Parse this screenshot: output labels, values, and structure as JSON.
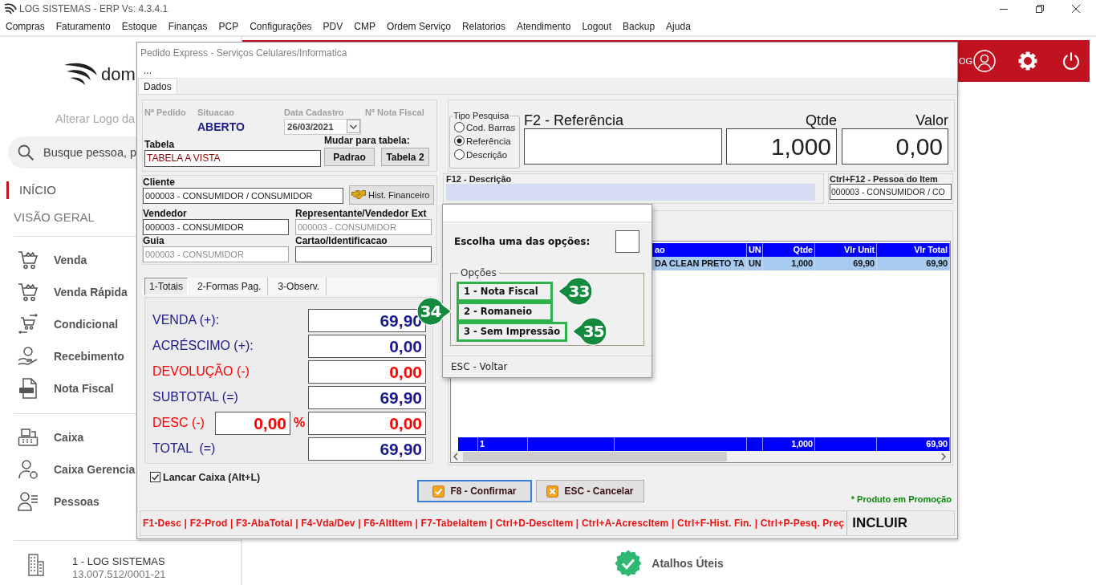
{
  "window": {
    "title": "LOG SISTEMAS - ERP Vs: 4.3.4.1"
  },
  "menu": [
    "Compras",
    "Faturamento",
    "Estoque",
    "Finanças",
    "PCP",
    "Configurações",
    "PDV",
    "CMP",
    "Ordem Serviço",
    "Relatorios",
    "Atendimento",
    "Logout",
    "Backup",
    "Ajuda"
  ],
  "sidebar": {
    "logo_text": "dom",
    "logo_caption": "Alterar Logo da",
    "search": {
      "placeholder": "Busque pessoa, p"
    },
    "sections": [
      {
        "label": "INÍCIO",
        "selected": true
      },
      {
        "label": "VISÃO GERAL",
        "selected": false
      }
    ],
    "groups": [
      [
        "Venda",
        "Venda Rápida",
        "Condicional",
        "Recebimento",
        "Nota Fiscal"
      ],
      [
        "Caixa",
        "Caixa Gerencia",
        "Pessoas"
      ]
    ],
    "company": {
      "name": "1 - LOG SISTEMAS",
      "document": "13.007.512/0001-21"
    }
  },
  "header": {
    "user": "OG"
  },
  "shortcuts_link": "Atalhos Úteis",
  "dialog": {
    "title": "Pedido Express - Serviços Celulares/Informatica",
    "menu_label": "...",
    "tabs": [
      {
        "label": "Dados",
        "selected": true
      }
    ],
    "order": {
      "number_label": "Nº Pedido",
      "status_label": "Situacao",
      "status": "ABERTO",
      "date_label": "Data Cadastro",
      "date": "26/03/2021",
      "invoice_label": "Nº Nota Fiscal",
      "table_label": "Tabela",
      "table": "TABELA A VISTA",
      "change_table_label": "Mudar para tabela:",
      "table_buttons": [
        "Padrao",
        "Tabela 2"
      ]
    },
    "people": {
      "client": {
        "label": "Cliente",
        "value": "000003 - CONSUMIDOR / CONSUMIDOR"
      },
      "history_button": "Hist. Financeiro",
      "fields": [
        {
          "label": "Vendedor",
          "value": "000003 - CONSUMIDOR",
          "disabled": false
        },
        {
          "label": "Representante/Vendedor Ext",
          "value": "000003 - CONSUMIDOR",
          "disabled": true
        },
        {
          "label": "Guia",
          "value": "000003 - CONSUMIDOR",
          "disabled": true
        },
        {
          "label": "Cartao/Identificacao",
          "disabled": false
        }
      ]
    },
    "totals_tabs": [
      {
        "label": "1-Totais",
        "selected": true
      },
      {
        "label": "2-Formas Pag.",
        "selected": false
      },
      {
        "label": "3-Observ.",
        "selected": false
      }
    ],
    "totals": [
      {
        "kind": "plain",
        "label": "VENDA (+):",
        "value": "69,90",
        "color": "#1a1a8c"
      },
      {
        "kind": "plain",
        "label": "ACRÉSCIMO (+):",
        "value": "0,00",
        "color": "#1a1a8c"
      },
      {
        "kind": "plain",
        "label": "DEVOLUÇÃO (-)",
        "value": "0,00",
        "color": "#ff0000"
      },
      {
        "kind": "plain",
        "label": "SUBTOTAL (=)",
        "value": "69,90",
        "color": "#1a1a8c"
      },
      {
        "kind": "percent",
        "label": "DESC (-)",
        "percent": "0,00",
        "percent_sign": "%",
        "value": "0,00",
        "color": "#ff0000"
      },
      {
        "kind": "plain",
        "label": "TOTAL  (=)",
        "value": "69,90",
        "color": "#1a1a8c"
      }
    ],
    "search": {
      "type_title": "Tipo Pesquisa",
      "types": [
        {
          "label": "Cod. Barras",
          "selected": false
        },
        {
          "label": "Referência",
          "selected": true
        },
        {
          "label": "Descrição",
          "selected": false
        }
      ],
      "reference_label": "F2 - Referência",
      "quantity_label": "Qtde",
      "quantity": "1,000",
      "price_label": "Valor",
      "price": "0,00"
    },
    "description_label": "F12 - Descrição",
    "item_person": {
      "label": "Ctrl+F12 - Pessoa do Item",
      "value": "000003 - CONSUMIDOR / CO"
    },
    "grid": {
      "columns": [
        "ao",
        "UN",
        "Qtde",
        "Vlr Unit",
        "Vlr Total"
      ],
      "rows": [
        {
          "cells": [
            "DA CLEAN PRETO TA",
            "UN",
            "1,000",
            "69,90",
            "69,90"
          ],
          "selected": true
        }
      ],
      "footer": {
        "count": "1",
        "quantity": "1,000",
        "total": "69,90"
      }
    },
    "cash_checkbox": {
      "label": "Lancar Caixa (Alt+L)",
      "checked": true
    },
    "buttons": [
      {
        "label": "F8 - Confirmar",
        "kind": "confirm",
        "focused": true
      },
      {
        "label": "ESC - Cancelar",
        "kind": "cancel",
        "focused": false
      }
    ],
    "promo_note": "* Produto em Promoção",
    "shortcuts": "F1-Desc | F2-Prod | F3-AbaTotal | F4-Vda/Dev | F6-AltItem | F7-TabelaItem | Ctrl+D-DescItem | Ctrl+A-AcrescItem | Ctrl+F-Hist. Fin. | Ctrl+P-Pesq. Preç",
    "mode": "INCLUIR"
  },
  "popup": {
    "prompt": "Escolha uma das opções:",
    "group_title": "Opções",
    "options": [
      {
        "label": "1 - Nota Fiscal",
        "callout": "33",
        "callout_on_left": false
      },
      {
        "label": "2 - Romaneio",
        "callout": "34",
        "callout_on_left": true
      },
      {
        "label": "3 - Sem Impressão",
        "callout": "35",
        "callout_on_left": false
      }
    ],
    "footer": "ESC - Voltar"
  }
}
